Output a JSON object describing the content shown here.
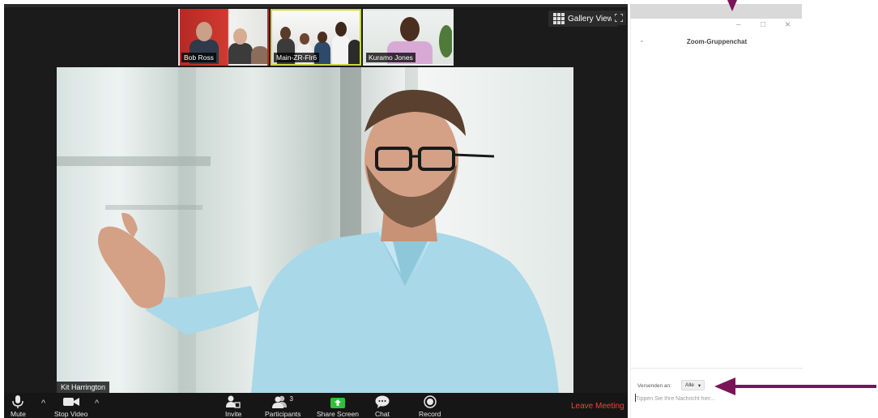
{
  "meeting": {
    "participants_thumbs": [
      {
        "name": "Bob Ross"
      },
      {
        "name": "Main-ZR-Flr6"
      },
      {
        "name": "Kuramo Jones"
      }
    ],
    "gallery_view_label": "Gallery View",
    "active_speaker_name": "Kit Harrington"
  },
  "toolbar": {
    "mute_label": "Mute",
    "stop_video_label": "Stop Video",
    "invite_label": "Invite",
    "participants_label": "Participants",
    "participants_count": "3",
    "share_screen_label": "Share Screen",
    "chat_label": "Chat",
    "record_label": "Record",
    "leave_label": "Leave Meeting",
    "caret": "^"
  },
  "chat": {
    "title": "Zoom-Gruppenchat",
    "minimize": "–",
    "maximize": "□",
    "close": "×",
    "collapse": "⌄",
    "send_to_label": "Versenden an:",
    "recipient": "Alle",
    "recipient_caret": "▾",
    "input_placeholder": "Tippen Sie Ihre Nachricht hier..."
  },
  "colors": {
    "leave": "#e8483a",
    "share_screen": "#2fbf3a",
    "annotation": "#7a1458"
  }
}
